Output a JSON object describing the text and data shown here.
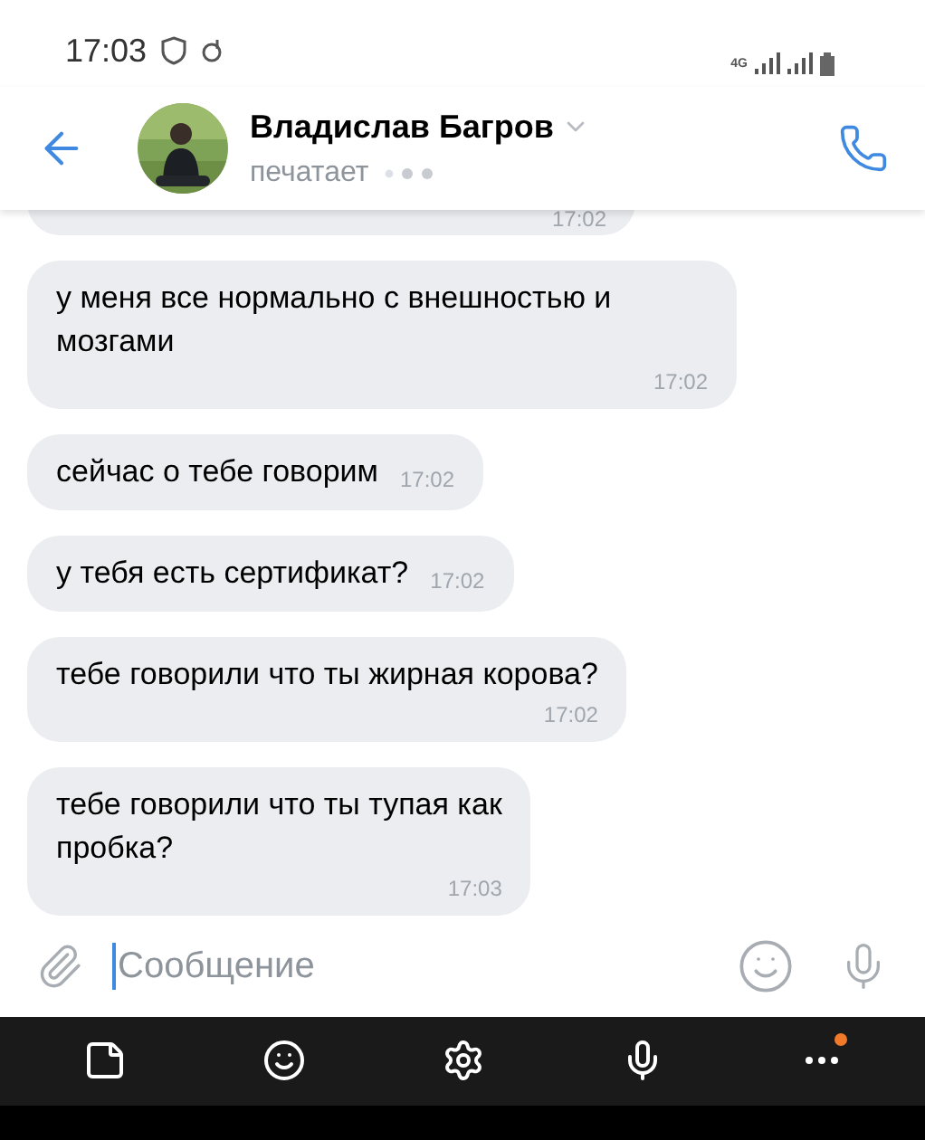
{
  "status_bar": {
    "time": "17:03",
    "network": "4G"
  },
  "header": {
    "name": "Владислав Багров",
    "status": "печатает"
  },
  "messages": [
    {
      "time": "17:02",
      "kind": "cut"
    },
    {
      "text": "у меня все нормально с внешностью и мозгами",
      "time": "17:02",
      "kind": "block"
    },
    {
      "text": "сейчас о тебе говорим",
      "time": "17:02",
      "kind": "inline"
    },
    {
      "text": "у тебя есть сертификат?",
      "time": "17:02",
      "kind": "inline"
    },
    {
      "text": "тебе говорили что ты жирная корова?",
      "time": "17:02",
      "kind": "block"
    },
    {
      "text": "тебе говорили что ты тупая как\nпробка?",
      "time": "17:03",
      "kind": "block"
    }
  ],
  "composer": {
    "placeholder": "Сообщение"
  },
  "keyboard_toolbar": {
    "more_badge": true
  }
}
